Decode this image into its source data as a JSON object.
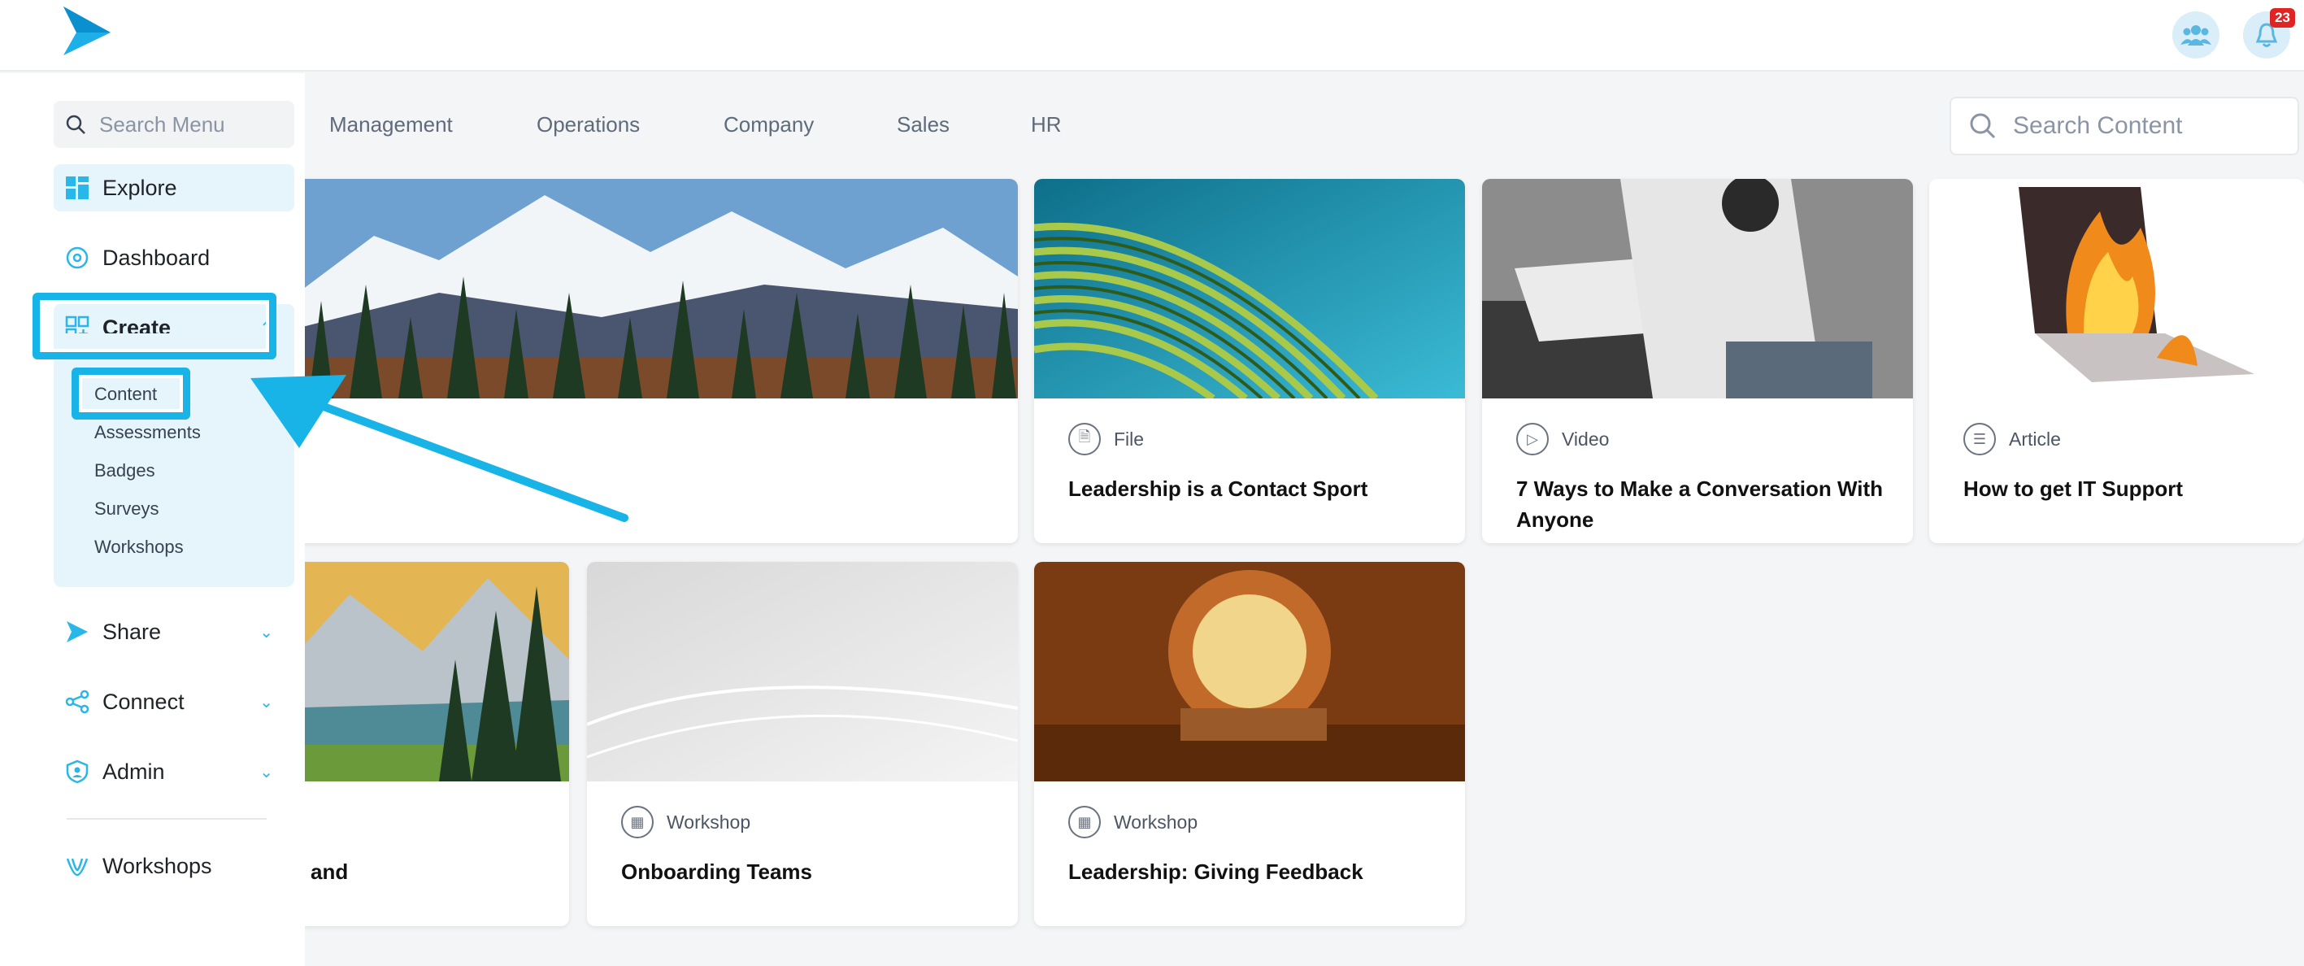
{
  "header": {
    "notification_count": "23"
  },
  "categories": [
    "Management",
    "Operations",
    "Company",
    "Sales",
    "HR"
  ],
  "search": {
    "content_placeholder": "Search Content",
    "menu_placeholder": "Search Menu"
  },
  "sidebar": {
    "explore": "Explore",
    "dashboard": "Dashboard",
    "create": "Create",
    "create_items": [
      "Content",
      "Assessments",
      "Badges",
      "Surveys",
      "Workshops"
    ],
    "share": "Share",
    "connect": "Connect",
    "admin": "Admin",
    "workshops": "Workshops"
  },
  "cards": [
    {
      "type": "File",
      "title": "Leadership is a Contact Sport"
    },
    {
      "type": "Video",
      "title": "7 Ways to Make a Conversation With Anyone"
    },
    {
      "type": "Article",
      "title": "How to get IT Support"
    },
    {
      "type": "",
      "title": "and"
    },
    {
      "type": "Workshop",
      "title": "Onboarding Teams"
    },
    {
      "type": "Workshop",
      "title": "Leadership: Giving Feedback"
    }
  ],
  "colors": {
    "accent": "#18b4e8",
    "sidebar_active": "#e6f4fb",
    "badge": "#e02424"
  }
}
